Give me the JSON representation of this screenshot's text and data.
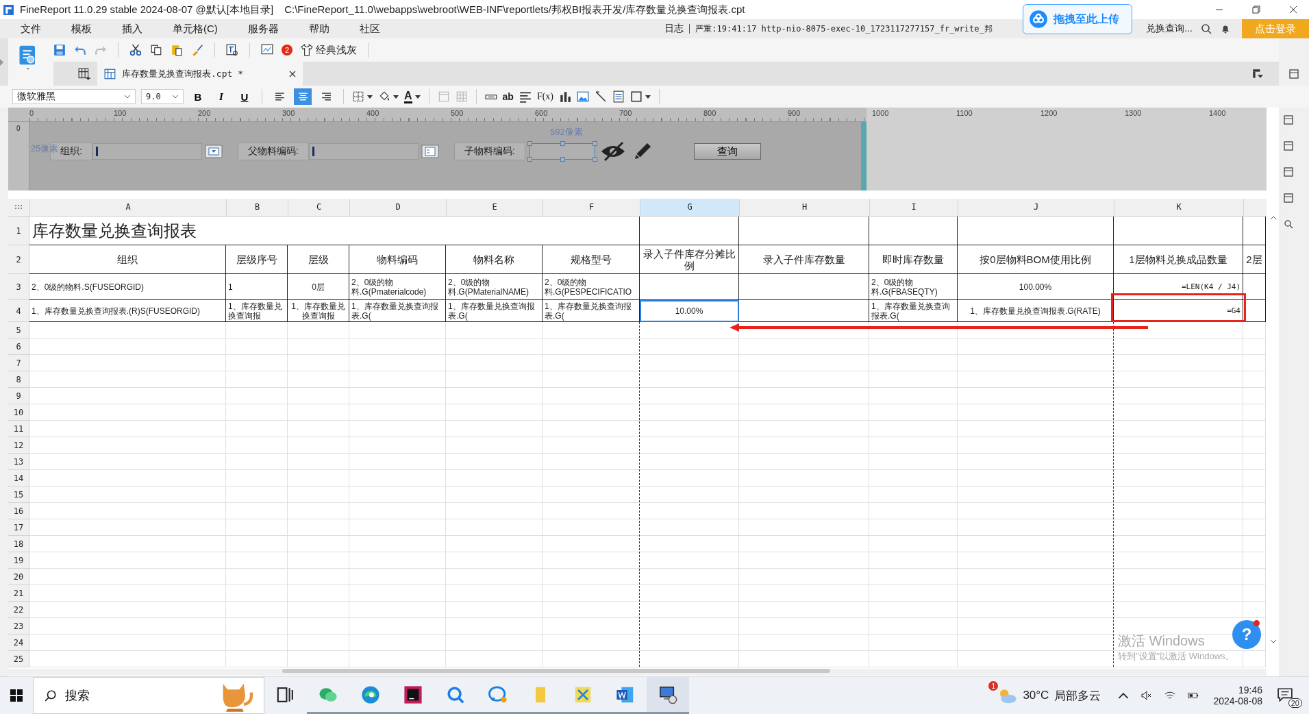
{
  "title_bar": {
    "app": "FineReport 11.0.29 stable 2024-08-07 @默认[本地目录]",
    "path": "C:\\FineReport_11.0\\webapps\\webroot\\WEB-INF\\reportlets/邦权BI报表开发/库存数量兑换查询报表.cpt"
  },
  "upload_badge": "拖拽至此上传",
  "menu": [
    "文件",
    "模板",
    "插入",
    "单元格(C)",
    "服务器",
    "帮助",
    "社区"
  ],
  "log": {
    "label": "日志",
    "message": "严重:19:41:17 http-nio-8075-exec-10_1723117277157_fr_write_邦",
    "tail": "兑换查询..."
  },
  "login_button": "点击登录",
  "toolbar": {
    "notifications": "2",
    "theme": "经典浅灰"
  },
  "tabs": [
    {
      "label": "库存数量兑换查询报表.cpt *",
      "selected": true
    }
  ],
  "format_bar": {
    "font": "微软雅黑",
    "size": "9.0",
    "bold": "B",
    "italic": "I",
    "underline": "U",
    "font_color": "A",
    "text_tool": "ab",
    "formula": "F(x)",
    "align": [
      {
        "kind": "left",
        "selected": false
      },
      {
        "kind": "center",
        "selected": true
      },
      {
        "kind": "right",
        "selected": false
      }
    ]
  },
  "vertical_ruler": "0",
  "ruler": [
    "0",
    "100",
    "200",
    "300",
    "400",
    "500",
    "600",
    "700",
    "800",
    "900",
    "1000",
    "1100",
    "1200",
    "1300",
    "1400"
  ],
  "parameter_panel": {
    "top_offset": "25像素",
    "width_hint": "592像素",
    "query_button": "查询",
    "fields": [
      {
        "label": "组织:",
        "kind": "dropdown"
      },
      {
        "label": "父物料编码:",
        "kind": "tree"
      },
      {
        "label": "子物料编码:",
        "kind": "hidden"
      }
    ]
  },
  "sheet": {
    "columns": [
      {
        "label": "A",
        "selected": false
      },
      {
        "label": "B",
        "selected": false
      },
      {
        "label": "C",
        "selected": false
      },
      {
        "label": "D",
        "selected": false
      },
      {
        "label": "E",
        "selected": false
      },
      {
        "label": "F",
        "selected": false
      },
      {
        "label": "G",
        "selected": true
      },
      {
        "label": "H",
        "selected": false
      },
      {
        "label": "I",
        "selected": false
      },
      {
        "label": "J",
        "selected": false
      },
      {
        "label": "K",
        "selected": false
      }
    ],
    "title": {
      "row": "1",
      "text": "库存数量兑换查询报表"
    },
    "rows": [
      {
        "number": "2",
        "kind": "header",
        "cells": [
          {
            "text": "组织"
          },
          {
            "text": "层级序号"
          },
          {
            "text": "层级"
          },
          {
            "text": "物料编码"
          },
          {
            "text": "物料名称"
          },
          {
            "text": "规格型号"
          },
          {
            "text": "录入子件库存分摊比例"
          },
          {
            "text": "录入子件库存数量"
          },
          {
            "text": "即时库存数量"
          },
          {
            "text": "按0层物料BOM使用比例"
          },
          {
            "text": "1层物料兑换成品数量"
          },
          {
            "text": "2层"
          }
        ]
      },
      {
        "number": "3",
        "kind": "data",
        "cells": [
          {
            "text": "2、0级的物料.S(FUSEORGID)"
          },
          {
            "text": "1"
          },
          {
            "text": "0层"
          },
          {
            "text": "2、0级的物料.G(Pmaterialcode)"
          },
          {
            "text": "2、0级的物料.G(PMaterialNAME)"
          },
          {
            "text": "2、0级的物料.G(PESPECIFICATIO"
          },
          {
            "text": ""
          },
          {
            "text": ""
          },
          {
            "text": "2、0级的物料.G(FBASEQTY)"
          },
          {
            "text": "100.00%"
          },
          {
            "text": "=LEN(K4 / J4)"
          },
          {
            "text": ""
          }
        ]
      },
      {
        "number": "4",
        "kind": "data",
        "cells": [
          {
            "text": "1、库存数量兑换查询报表.(R)S(FUSEORGID)"
          },
          {
            "text": "1、库存数量兑换查询报"
          },
          {
            "text": "1、库存数量兑换查询报"
          },
          {
            "text": "1、库存数量兑换查询报表.G("
          },
          {
            "text": "1、库存数量兑换查询报表.G("
          },
          {
            "text": "1、库存数量兑换查询报表.G("
          },
          {
            "text": "10.00%",
            "selected": true
          },
          {
            "text": ""
          },
          {
            "text": "1、库存数量兑换查询报表.G("
          },
          {
            "text": "1、库存数量兑换查询报表.G(RATE)"
          },
          {
            "text": "=G4",
            "boxed": true
          },
          {
            "text": ""
          }
        ]
      }
    ],
    "empty_rows": [
      "5",
      "6",
      "7",
      "8",
      "9",
      "10",
      "11",
      "12",
      "13",
      "14",
      "15",
      "16",
      "17",
      "18",
      "19",
      "20",
      "21",
      "22",
      "23",
      "24",
      "25"
    ],
    "annotation": {
      "kind": "arrow"
    }
  },
  "help_button": "?",
  "activation": {
    "title": "激活 Windows",
    "hint": "转到\"设置\"以激活 Windows。"
  },
  "taskbar": {
    "search": "搜索",
    "apps": [
      {
        "kind": "taskview",
        "running": false
      },
      {
        "kind": "wechat",
        "running": true
      },
      {
        "kind": "edge",
        "running": true
      },
      {
        "kind": "rider",
        "running": true
      },
      {
        "kind": "search",
        "running": true
      },
      {
        "kind": "chat",
        "running": true
      },
      {
        "kind": "folder",
        "running": true
      },
      {
        "kind": "tool",
        "running": true
      },
      {
        "kind": "word",
        "running": true
      },
      {
        "kind": "remote",
        "running": true
      }
    ],
    "weather": {
      "badge": "1",
      "temp": "30°C",
      "text": "局部多云"
    },
    "time": "19:46",
    "date": "2024-08-08",
    "notifications": "20"
  }
}
